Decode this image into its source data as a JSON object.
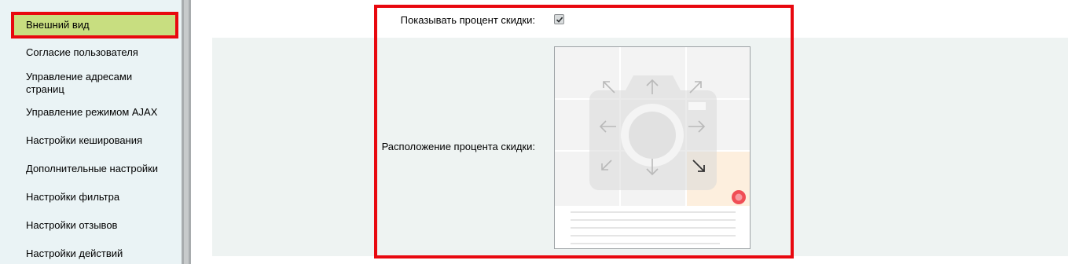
{
  "sidebar": {
    "items": [
      {
        "id": "appearance",
        "label": "Внешний вид",
        "active": true
      },
      {
        "id": "user-consent",
        "label": "Согласие пользователя"
      },
      {
        "id": "url-management",
        "label": "Управление адресами страниц"
      },
      {
        "id": "ajax-mode",
        "label": "Управление режимом AJAX"
      },
      {
        "id": "cache-settings",
        "label": "Настройки кеширования"
      },
      {
        "id": "additional-settings",
        "label": "Дополнительные настройки"
      },
      {
        "id": "filter-settings",
        "label": "Настройки фильтра"
      },
      {
        "id": "reviews-settings",
        "label": "Настройки отзывов"
      },
      {
        "id": "actions-settings",
        "label": "Настройки действий"
      }
    ],
    "active_color": "#c8de80"
  },
  "form": {
    "show_discount_label": "Показывать процент скидки:",
    "show_discount_checked": true,
    "discount_position_label": "Расположение процента скидки:",
    "discount_position_selected": "bottom-right",
    "positions": [
      "top-left",
      "top",
      "top-right",
      "left",
      "center",
      "right",
      "bottom-left",
      "bottom",
      "bottom-right"
    ]
  },
  "colors": {
    "highlight": "#e8080f",
    "panel_bg": "#eef3f2",
    "selected_cell": "#fdefde",
    "marker": "#f04e55"
  }
}
